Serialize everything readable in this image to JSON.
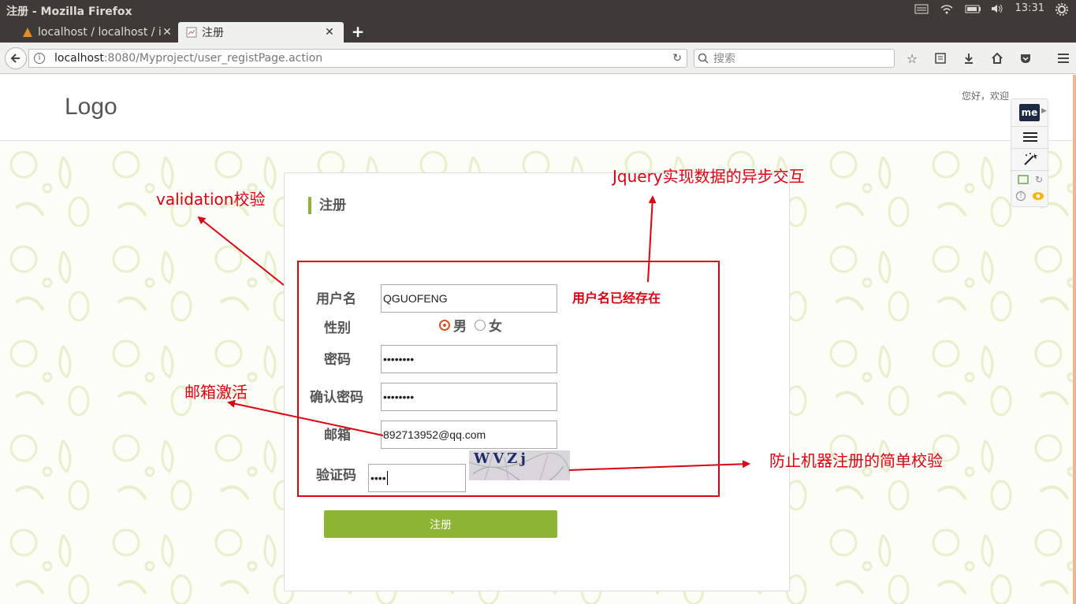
{
  "os": {
    "window_title": "注册 - Mozilla Firefox",
    "clock": "13:31"
  },
  "tabs": [
    {
      "label": "localhost / localhost / i"
    },
    {
      "label": "注册"
    }
  ],
  "nav": {
    "url_host": "localhost",
    "url_rest": ":8080/Myproject/user_registPage.action",
    "search_placeholder": "搜索"
  },
  "site": {
    "logo": "Logo",
    "greeting": "您好，欢迎"
  },
  "extension": {
    "badge": "me"
  },
  "form": {
    "title": "注册",
    "username_label": "用户名",
    "username_value": "QGUOFENG",
    "username_error": "用户名已经存在",
    "gender_label": "性别",
    "gender_male": "男",
    "gender_female": "女",
    "gender_selected": "男",
    "password_label": "密码",
    "password_value": "••••••••",
    "confirm_label": "确认密码",
    "confirm_value": "••••••••",
    "email_label": "邮箱",
    "email_value": "892713952@qq.com",
    "captcha_label": "验证码",
    "captcha_value": "••••",
    "captcha_text": "WVZj",
    "submit_label": "注册"
  },
  "annotations": {
    "validation": "validation校验",
    "jquery": "Jquery实现数据的异步交互",
    "email": "邮箱激活",
    "captcha": "防止机器注册的简单校验"
  },
  "colors": {
    "accent_green": "#8db432",
    "annotation_red": "#e0000f",
    "radio_orange": "#d9531e"
  }
}
